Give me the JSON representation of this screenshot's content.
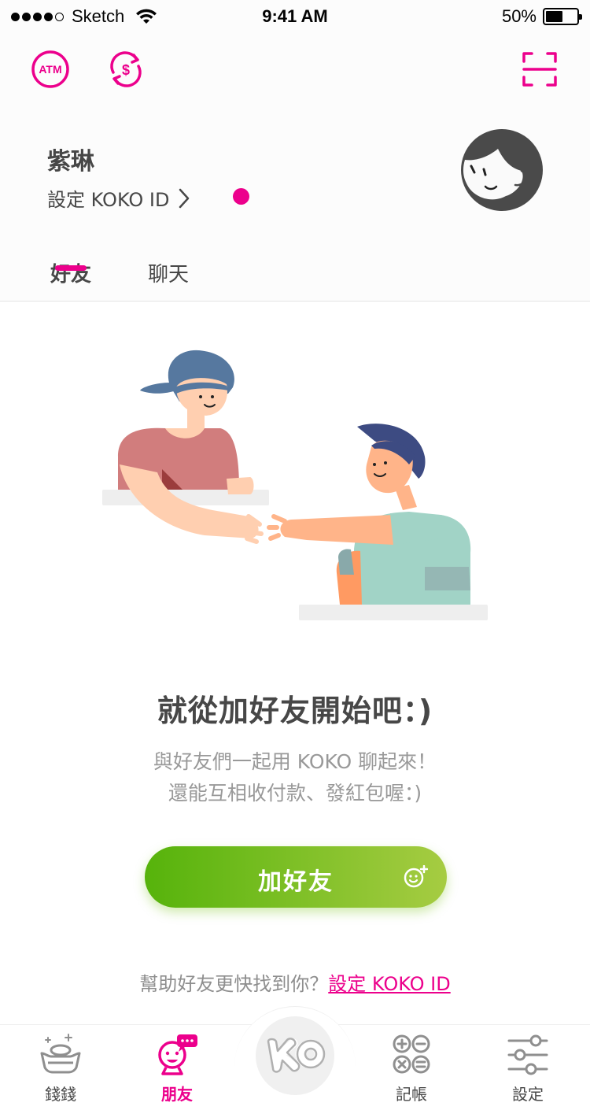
{
  "status_bar": {
    "carrier": "Sketch",
    "time": "9:41 AM",
    "battery_percent": "50%",
    "battery_level": 0.5,
    "signal_bars": 4
  },
  "header": {
    "icons": [
      "atm-icon",
      "currency-exchange-icon",
      "scan-icon"
    ],
    "atm_label": "ATM",
    "user_name": "紫琳",
    "kokoid_prompt": "設定 KOKO ID",
    "accent_color": "#ec008c"
  },
  "tabs": [
    {
      "label": "好友",
      "active": true
    },
    {
      "label": "聊天",
      "active": false
    }
  ],
  "empty_state": {
    "title": "就從加好友開始吧：)",
    "desc_line1": "與好友們一起用 KOKO 聊起來！",
    "desc_line2": "還能互相收付款、發紅包喔：)"
  },
  "add_friend_button": {
    "label": "加好友",
    "gradient": [
      "#56b30b",
      "#a6cc42"
    ]
  },
  "help": {
    "text": "幫助好友更快找到你？",
    "link": "設定 KOKO ID"
  },
  "tabbar": {
    "items": [
      {
        "label": "錢錢",
        "icon": "money-icon",
        "active": false
      },
      {
        "label": "朋友",
        "icon": "friends-icon",
        "active": true
      },
      {
        "label": "記帳",
        "icon": "accounting-icon",
        "active": false
      },
      {
        "label": "設定",
        "icon": "settings-sliders-icon",
        "active": false
      }
    ],
    "center_label": "KO"
  }
}
